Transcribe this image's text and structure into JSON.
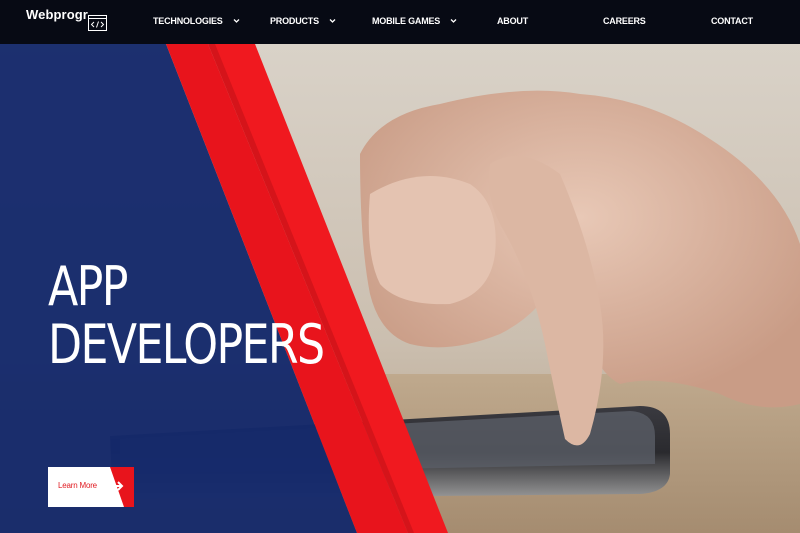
{
  "logo": {
    "text": "Webprogr",
    "icon": "code-icon"
  },
  "nav": {
    "items": [
      {
        "label": "TECHNOLOGIES",
        "has_dropdown": true
      },
      {
        "label": "PRODUCTS",
        "has_dropdown": true
      },
      {
        "label": "MOBILE GAMES",
        "has_dropdown": true
      },
      {
        "label": "ABOUT",
        "has_dropdown": false
      },
      {
        "label": "CAREERS",
        "has_dropdown": false
      },
      {
        "label": "CONTACT",
        "has_dropdown": false
      }
    ]
  },
  "hero": {
    "title_line1": "APP",
    "title_line2": "DEVELOPERS",
    "cta_label": "Learn More",
    "cta_icon": "arrow-right-icon"
  },
  "colors": {
    "nav_bg": "#070a14",
    "panel_blue": "#14296b",
    "accent_red": "#e8141c",
    "text": "#ffffff"
  }
}
